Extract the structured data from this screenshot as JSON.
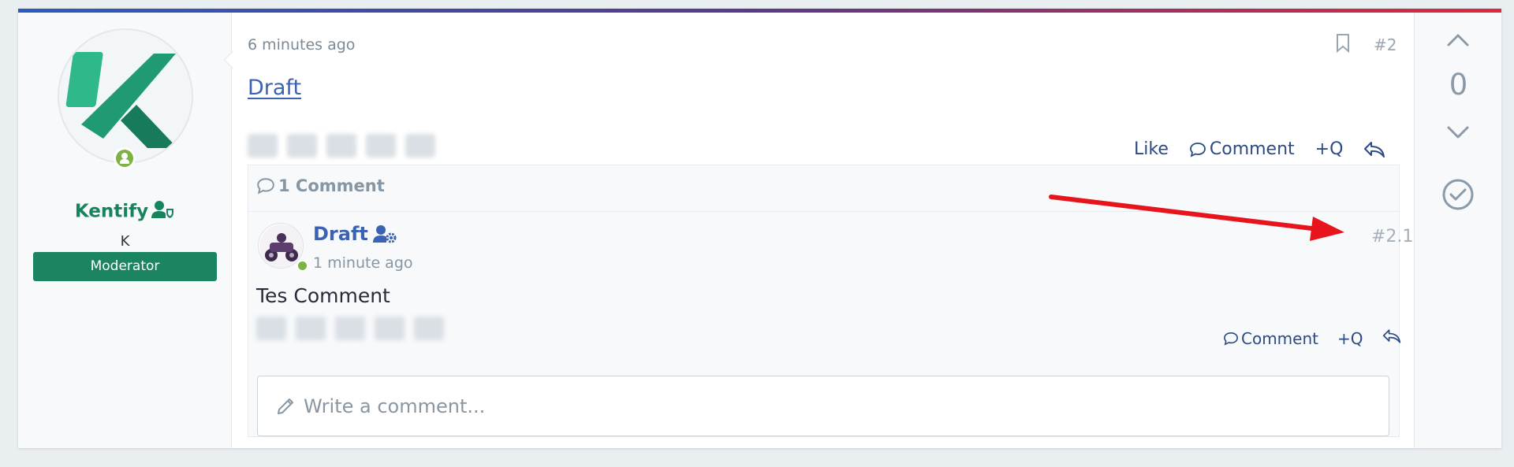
{
  "user": {
    "name": "Kentify",
    "subtitle": "K",
    "badge": "Moderator",
    "role_icon": "user-shield-icon",
    "online": true
  },
  "post": {
    "timestamp": "6 minutes ago",
    "number": "#2",
    "title": "Draft",
    "actions": {
      "like": "Like",
      "comment": "Comment",
      "quote": "+Q"
    }
  },
  "comments": {
    "header": "1 Comment",
    "items": [
      {
        "author": "Draft",
        "author_icon": "user-cog-icon",
        "time": "1 minute ago",
        "number": "#2.1",
        "body": "Tes Comment",
        "actions": {
          "comment": "Comment",
          "quote": "+Q"
        }
      }
    ],
    "input_placeholder": "Write a comment..."
  },
  "vote": {
    "count": "0"
  },
  "colors": {
    "accent": "#3b62b3",
    "username": "#17845e",
    "badge": "#1b8461",
    "annotation": "#e8141c"
  }
}
